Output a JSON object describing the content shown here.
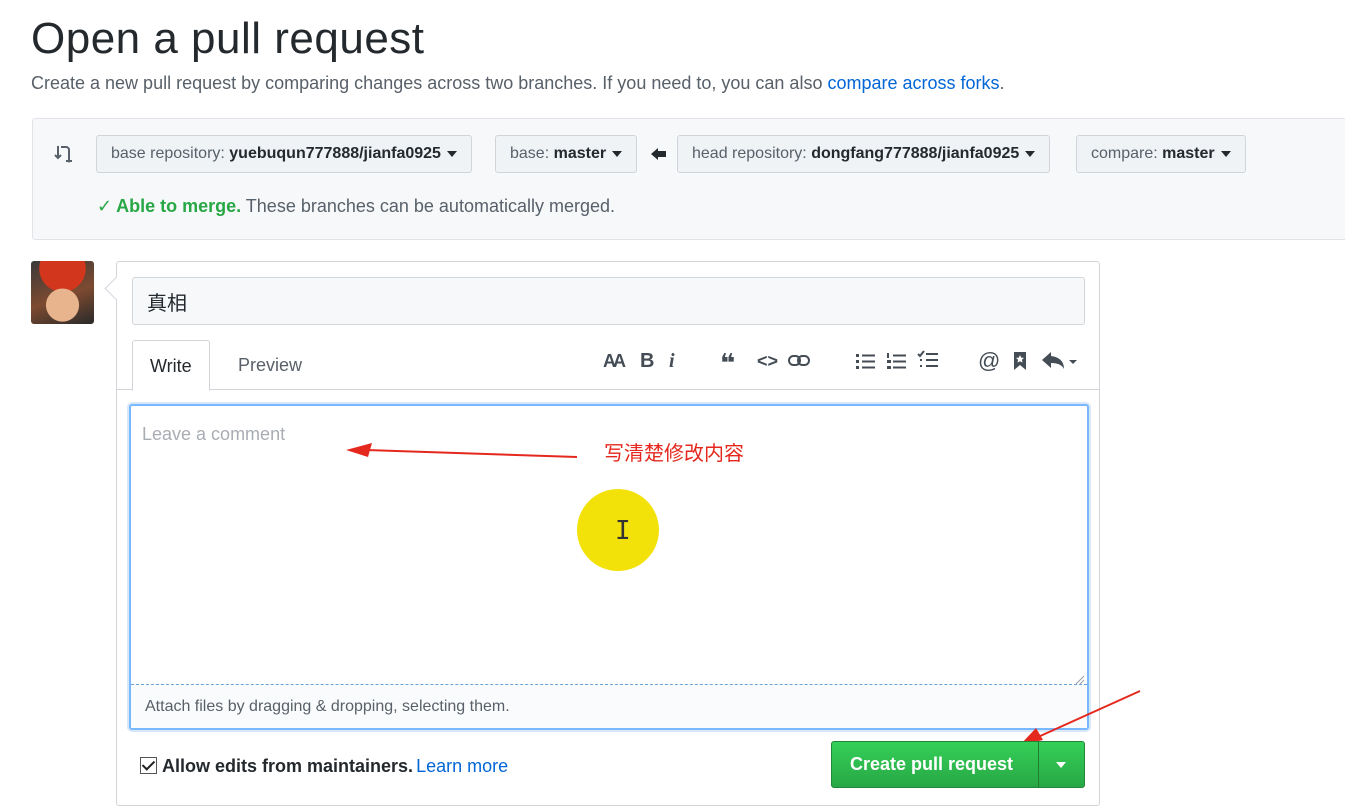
{
  "header": {
    "title": "Open a pull request",
    "subtitle": "Create a new pull request by comparing changes across two branches. If you need to, you can also ",
    "subtitle_link": "compare across forks",
    "subtitle_end": "."
  },
  "range": {
    "base_repo_prefix": "base repository: ",
    "base_repo": "yuebuqun777888/jianfa0925",
    "base_prefix": "base: ",
    "base_branch": "master",
    "head_repo_prefix": "head repository: ",
    "head_repo": "dongfang777888/jianfa0925",
    "compare_prefix": "compare: ",
    "compare_branch": "master",
    "merge_ok": "Able to merge.",
    "merge_msg": " These branches can be automatically merged.",
    "merge_check": "✓"
  },
  "form": {
    "title_value": "真相",
    "tabs": [
      "Write",
      "Preview"
    ],
    "toolbar": {
      "heading": "AA",
      "bold": "B",
      "italic": "i",
      "quote": "❝",
      "code": "<>",
      "mention": "@"
    },
    "comment_placeholder": "Leave a comment",
    "attach_hint": "Attach files by dragging & dropping, selecting them.",
    "allow_edits_label": "Allow edits from maintainers.",
    "learn_more": "Learn more",
    "submit_label": "Create pull request"
  },
  "overlay": {
    "annotation": "写清楚修改内容",
    "cursor_glyph": "I",
    "annotation_color": "#e5281e",
    "highlight_color": "#f3e20a"
  },
  "icons": [
    "compare-icon",
    "arrow-left-icon",
    "check-icon",
    "link-icon",
    "bulleted-list-icon",
    "numbered-list-icon",
    "task-list-icon",
    "bookmark-icon",
    "reply-icon"
  ]
}
